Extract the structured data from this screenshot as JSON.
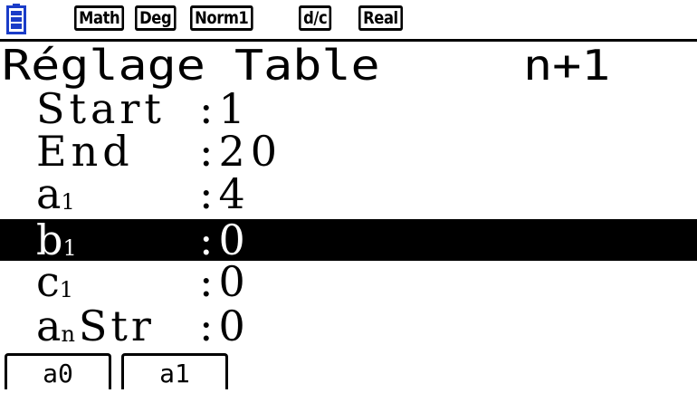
{
  "status_bar": {
    "battery_icon": "battery-icon",
    "tags": [
      "Math",
      "Deg",
      "Norm1",
      "d/c",
      "Real"
    ]
  },
  "screen": {
    "title": "Réglage Table",
    "mode": "n+1"
  },
  "settings": [
    {
      "label": "Start",
      "sub": "",
      "suffix": "",
      "value": "1"
    },
    {
      "label": "End",
      "sub": "",
      "suffix": "",
      "value": "20"
    },
    {
      "label": "a",
      "sub": "1",
      "suffix": "",
      "value": "4"
    },
    {
      "label": "b",
      "sub": "1",
      "suffix": "",
      "value": "0",
      "selected": true
    },
    {
      "label": "c",
      "sub": "1",
      "suffix": "",
      "value": "0"
    },
    {
      "label": "a",
      "sub": "n",
      "suffix": "Str",
      "value": "0"
    }
  ],
  "function_keys": [
    {
      "label": "a0"
    },
    {
      "label": "a1"
    }
  ]
}
